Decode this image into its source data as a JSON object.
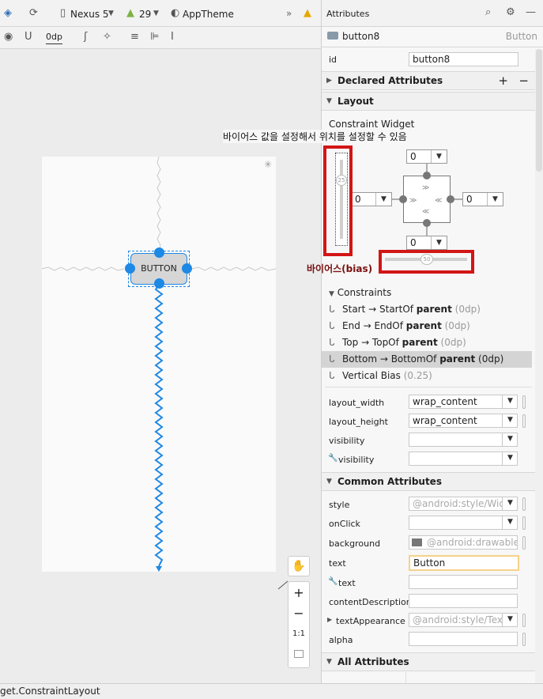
{
  "toolbar": {
    "device": "Nexus 5",
    "api": "29",
    "theme": "AppTheme",
    "overflow": "»",
    "margin_value": "0dp"
  },
  "design": {
    "button_text": "BUTTON",
    "annotation": "바이어스 값을 설정해서 위치를 설정할 수 있음",
    "bias_label": "바이어스(bias)"
  },
  "attributes": {
    "title": "Attributes",
    "component_name": "button8",
    "component_type": "Button",
    "id_label": "id",
    "id_value": "button8",
    "declared_section": "Declared Attributes",
    "layout_section": "Layout",
    "constraint_widget_label": "Constraint Widget",
    "margins": {
      "top": "0",
      "left": "0",
      "right": "0",
      "bottom": "0"
    },
    "vertical_bias": "25",
    "horizontal_bias": "50",
    "constraints_label": "Constraints",
    "constraints": [
      {
        "pre": "Start → StartOf ",
        "target": "parent",
        "dp": " (0dp)"
      },
      {
        "pre": "End → EndOf ",
        "target": "parent",
        "dp": " (0dp)"
      },
      {
        "pre": "Top → TopOf ",
        "target": "parent",
        "dp": " (0dp)"
      },
      {
        "pre": "Bottom → BottomOf ",
        "target": "parent",
        "dp": " (0dp)"
      },
      {
        "pre": "Vertical Bias ",
        "target": "",
        "dp": " (0.25)"
      }
    ],
    "layout_rows": [
      {
        "label": "layout_width",
        "value": "wrap_content"
      },
      {
        "label": "layout_height",
        "value": "wrap_content"
      },
      {
        "label": "visibility",
        "value": ""
      },
      {
        "label": "visibility",
        "value": ""
      }
    ],
    "common_section": "Common Attributes",
    "common_rows": [
      {
        "label": "style",
        "value": "@android:style/Wic"
      },
      {
        "label": "onClick",
        "value": ""
      },
      {
        "label": "background",
        "value": "@android:drawable/b"
      },
      {
        "label": "text",
        "value": "Button"
      },
      {
        "label": "text",
        "value": ""
      },
      {
        "label": "contentDescription",
        "value": ""
      },
      {
        "label": "textAppearance",
        "value": "@android:style/Tex"
      },
      {
        "label": "alpha",
        "value": ""
      }
    ],
    "all_section": "All Attributes"
  },
  "status_text": "get.ConstraintLayout",
  "zoom": {
    "plus": "+",
    "minus": "−",
    "one": "1:1"
  },
  "colors": {
    "accent": "#1e88e5",
    "highlight": "#d21515"
  }
}
